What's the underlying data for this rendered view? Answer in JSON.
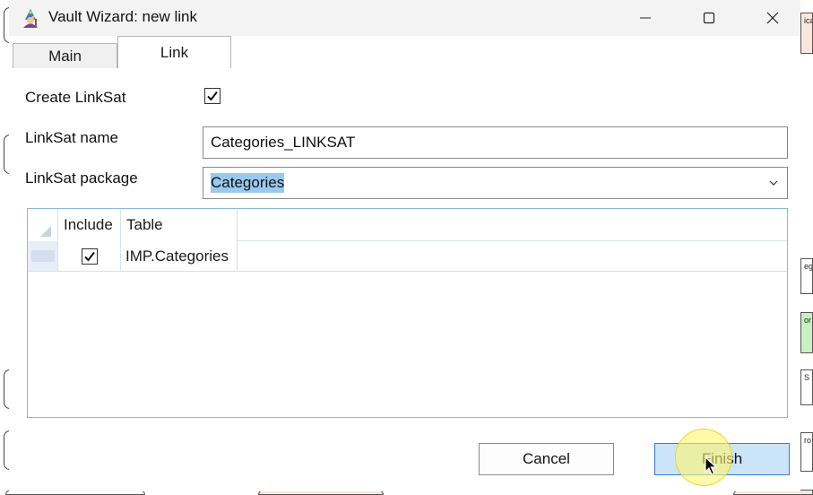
{
  "window": {
    "title": "Vault Wizard: new link",
    "controls": {
      "minimize": "—",
      "maximize": "☐",
      "close": "✕"
    }
  },
  "tabs": [
    {
      "label": "Main",
      "active": false
    },
    {
      "label": "Link",
      "active": true
    }
  ],
  "form": {
    "create_linksat_label": "Create LinkSat",
    "create_linksat_checked": true,
    "linksat_name_label": "LinkSat name",
    "linksat_name_value": "Categories_LINKSAT",
    "linksat_package_label": "LinkSat package",
    "linksat_package_value": "Categories"
  },
  "grid": {
    "columns": [
      "Include",
      "Table"
    ],
    "rows": [
      {
        "include": true,
        "table": "IMP.Categories"
      }
    ]
  },
  "buttons": {
    "cancel": "Cancel",
    "finish": "Finish"
  },
  "background": {
    "fragments": [
      "ica",
      "eg",
      "or",
      "S",
      "ro"
    ]
  },
  "colors": {
    "accent": "#2f7fd4",
    "finish_bg": "#cce4f7",
    "selection": "#99c9ef",
    "bg_green": "#c8f0c0",
    "bg_peach": "#fbe6dc"
  }
}
